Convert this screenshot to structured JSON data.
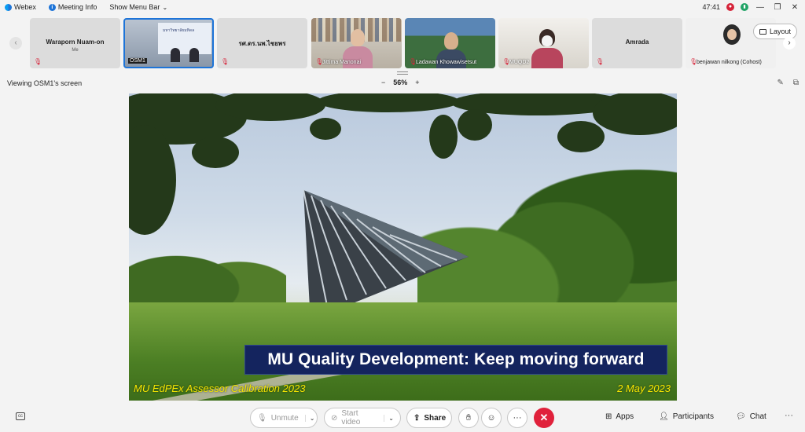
{
  "titlebar": {
    "app_name": "Webex",
    "meeting_info": "Meeting Info",
    "show_menu_bar": "Show Menu Bar",
    "timer": "47:41",
    "rec_symbol": "●",
    "network_symbol": "▮",
    "win_minimize": "—",
    "win_restore": "❐",
    "win_close": "✕"
  },
  "participants": {
    "tiles": [
      {
        "name": "Waraporn Nuam-on",
        "sub": "Me",
        "muted": true
      },
      {
        "name": "OSM1",
        "muted": false,
        "selected": true
      },
      {
        "name": "รศ.ดร.นพ.ไชยพร",
        "muted": true
      },
      {
        "name": "Jittima Manonai",
        "muted": true
      },
      {
        "name": "Ladawan Khowawisetsut",
        "muted": true
      },
      {
        "name": "MUQD2",
        "muted": true
      },
      {
        "name": "Amrada",
        "muted": true
      },
      {
        "name": "benjawan nilkong (Cohost)",
        "muted": true
      }
    ],
    "nav_left": "‹",
    "nav_right": "›",
    "layout_label": "Layout"
  },
  "viewbar": {
    "viewing_text": "Viewing OSM1's screen",
    "zoom_out": "−",
    "zoom_level": "56%",
    "zoom_in": "+"
  },
  "slide": {
    "banner": "MU Quality Development: Keep moving forward",
    "footer_left": "MU EdPEx Assessor Calibration 2023",
    "footer_right": "2 May 2023",
    "osm_screen_text": "มหาวิทยาลัยมหิดล"
  },
  "controls": {
    "unmute": "Unmute",
    "start_video": "Start video",
    "share": "Share",
    "more": "···",
    "end": "✕",
    "apps": "Apps",
    "participants": "Participants",
    "chat": "Chat",
    "overflow": "···",
    "caption_icon": "cc"
  },
  "colors": {
    "accent": "#1d74d8",
    "end_red": "#e0213b",
    "banner_bg": "#14245e",
    "footer_text": "#f5e600"
  }
}
